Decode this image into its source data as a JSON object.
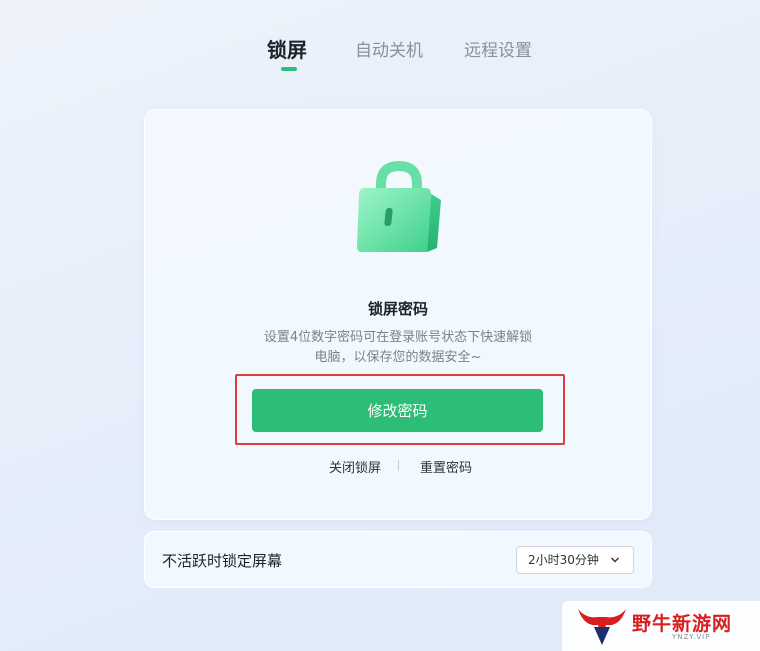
{
  "tabs": [
    {
      "label": "锁屏",
      "active": true
    },
    {
      "label": "自动关机",
      "active": false
    },
    {
      "label": "远程设置",
      "active": false
    }
  ],
  "lock_card": {
    "icon": "padlock-icon",
    "title": "锁屏密码",
    "description": "设置4位数字密码可在登录账号状态下快速解锁电脑，以保存您的数据安全~",
    "primary_button": "修改密码",
    "links": {
      "close": "关闭锁屏",
      "reset": "重置密码"
    }
  },
  "inactivity": {
    "label": "不活跃时锁定屏幕",
    "selected": "2小时30分钟",
    "icon": "chevron-down-icon"
  },
  "watermark": {
    "name": "野牛新游网",
    "sub": "YNZY.VIP"
  },
  "colors": {
    "accent": "#2dbd76",
    "highlight": "#e23b3b",
    "watermark": "#d81e1e"
  }
}
